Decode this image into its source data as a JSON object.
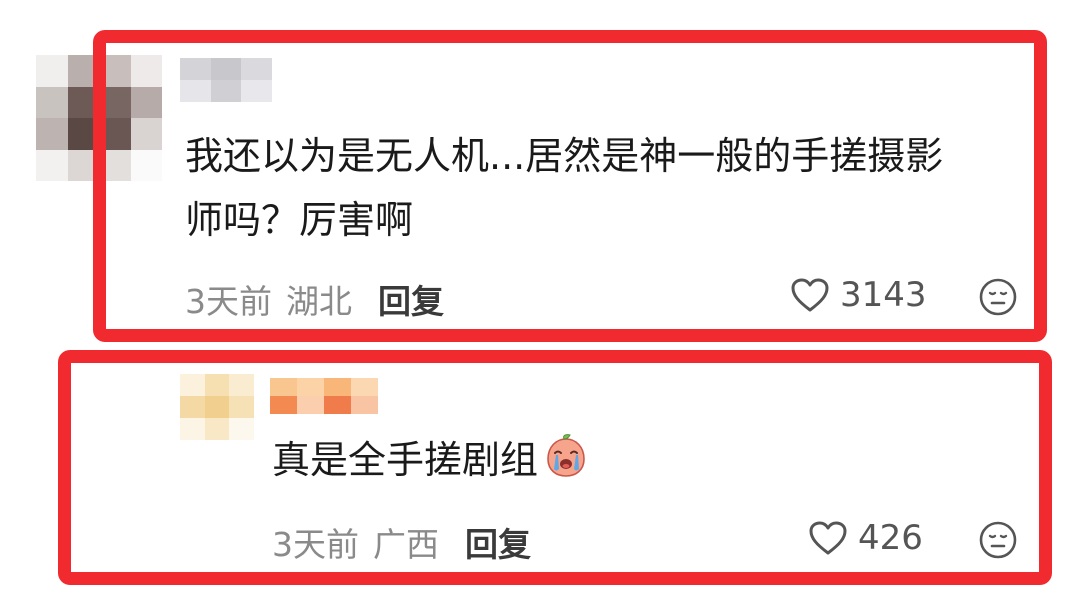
{
  "colors": {
    "highlight": "#f02a2f",
    "text": "#1a1a1a",
    "meta": "#8a8a8a",
    "reply": "#3a3a3a"
  },
  "comment1": {
    "text_line1": "我还以为是无人机...居然是神一般的手搓摄影",
    "text_line2": "师吗？厉害啊",
    "time": "3天前",
    "location": "湖北",
    "reply_label": "回复",
    "likes": "3143",
    "like_icon": "heart-outline-icon",
    "reaction_icon": "neutral-face-icon"
  },
  "comment2": {
    "text": "真是全手搓剧组",
    "emoji": "crying-peach-emoji",
    "time": "3天前",
    "location": "广西",
    "reply_label": "回复",
    "likes": "426",
    "like_icon": "heart-outline-icon",
    "reaction_icon": "neutral-face-icon"
  }
}
